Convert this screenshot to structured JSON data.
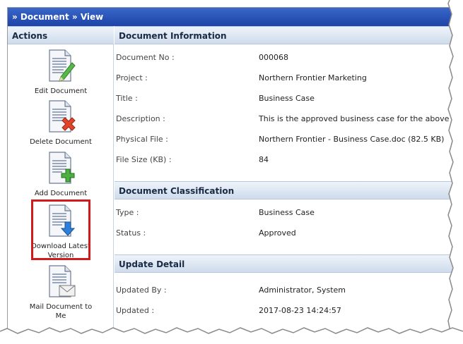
{
  "title_bar": "» Document » View",
  "sidebar": {
    "header": "Actions",
    "actions": [
      {
        "label": "Edit Document",
        "icon": "edit-document-icon"
      },
      {
        "label": "Delete Document",
        "icon": "delete-document-icon"
      },
      {
        "label": "Add Document",
        "icon": "add-document-icon"
      },
      {
        "label": "Download Latest Version",
        "icon": "download-document-icon"
      },
      {
        "label": "Mail Document to Me",
        "icon": "mail-document-icon"
      }
    ]
  },
  "document_information": {
    "header": "Document Information",
    "rows": [
      {
        "label": "Document No :",
        "value": "000068"
      },
      {
        "label": "Project :",
        "value": "Northern Frontier Marketing"
      },
      {
        "label": "Title :",
        "value": "Business Case"
      },
      {
        "label": "Description :",
        "value": "This is the approved business case for the above mentio"
      },
      {
        "label": "Physical File :",
        "value": "Northern Frontier - Business Case.doc (82.5 KB)"
      },
      {
        "label": "File Size (KB) :",
        "value": "84"
      }
    ]
  },
  "document_classification": {
    "header": "Document Classification",
    "rows": [
      {
        "label": "Type :",
        "value": "Business Case"
      },
      {
        "label": "Status :",
        "value": "Approved"
      }
    ]
  },
  "update_detail": {
    "header": "Update Detail",
    "rows": [
      {
        "label": "Updated By :",
        "value": "Administrator, System"
      },
      {
        "label": "Updated :",
        "value": "2017-08-23 14:24:57"
      }
    ]
  },
  "colors": {
    "title_bar": "#1d43a7",
    "highlight": "#d11a1a",
    "section_header": "#cfdcec"
  }
}
